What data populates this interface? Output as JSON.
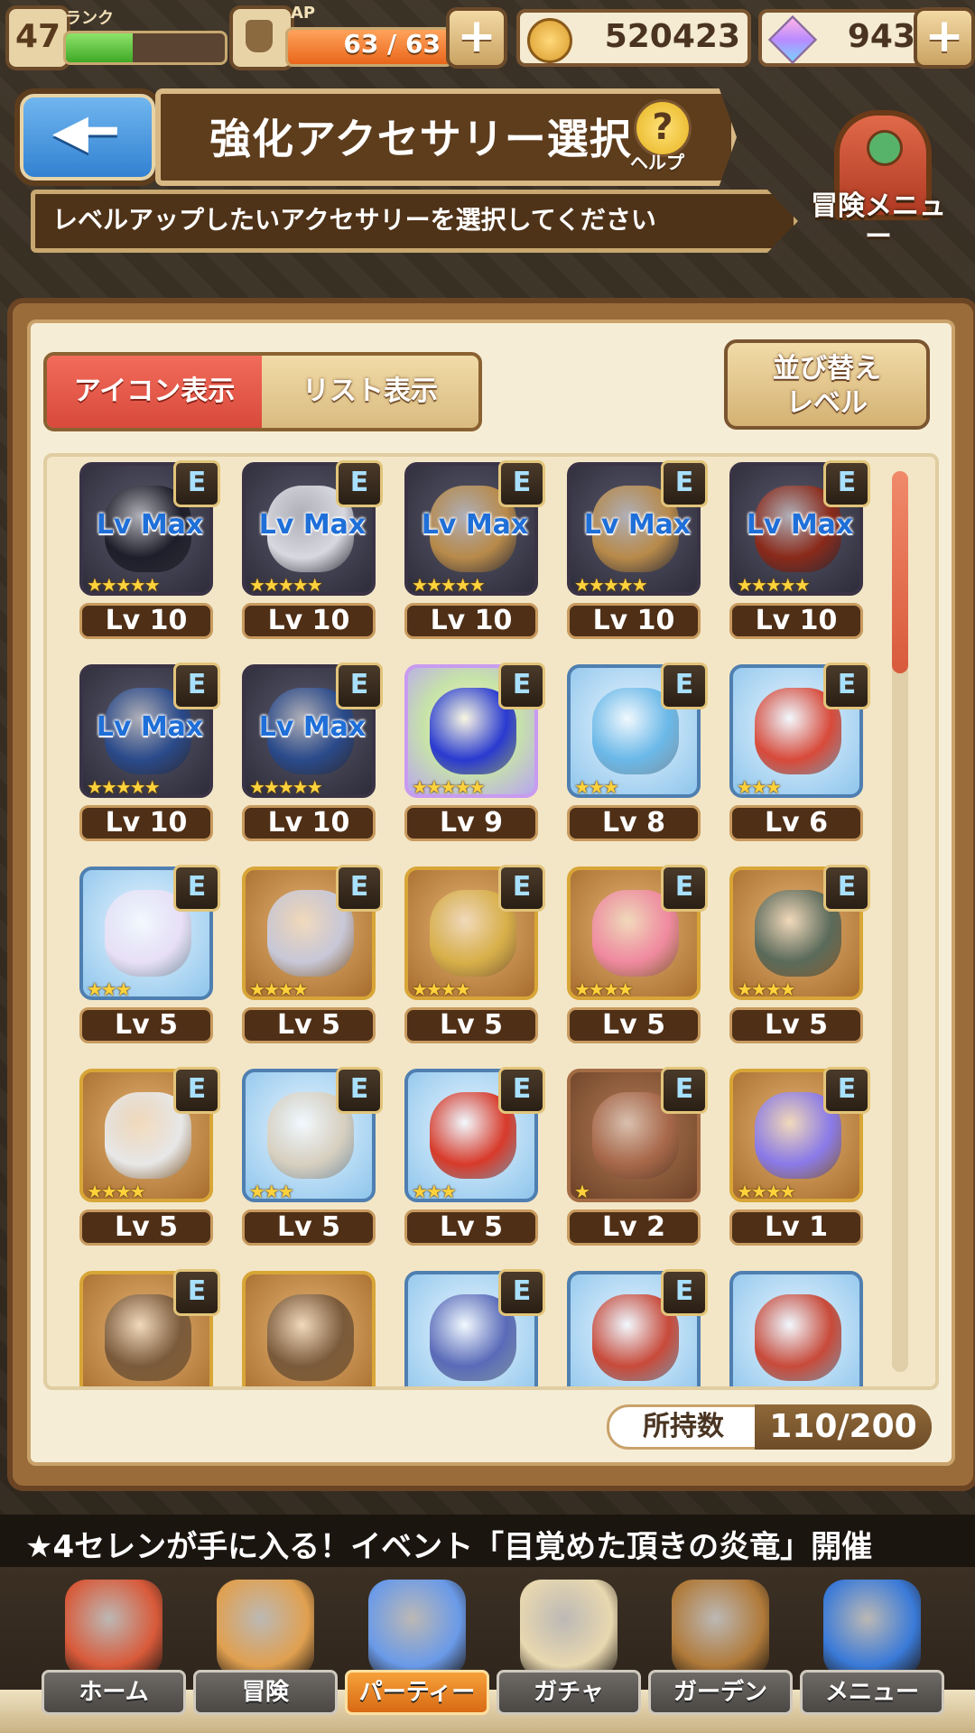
{
  "status": {
    "rank_level": "47",
    "rank_label": "ランク",
    "rank_progress": 0.42,
    "ap_label": "AP",
    "ap_value": "63 / 63",
    "ap_progress": 1.0,
    "coins": "520423",
    "gems": "943"
  },
  "header": {
    "title": "強化アクセサリー選択",
    "help_label": "ヘルプ",
    "subtitle": "レベルアップしたいアクセサリーを選択してください",
    "adventure_menu_label": "冒険メニュー"
  },
  "view_toggle": {
    "icon_view": "アイコン表示",
    "list_view": "リスト表示"
  },
  "sort_button": {
    "line1": "並び替え",
    "line2": "レベル"
  },
  "items": [
    {
      "lv": "Lv 10",
      "badge": "E",
      "lvmax": "Lv Max",
      "stars": "★★★★★",
      "rarity": "dark",
      "color": "#1e1e2a"
    },
    {
      "lv": "Lv 10",
      "badge": "E",
      "lvmax": "Lv Max",
      "stars": "★★★★★",
      "rarity": "dark",
      "color": "#d8d8e0"
    },
    {
      "lv": "Lv 10",
      "badge": "E",
      "lvmax": "Lv Max",
      "stars": "★★★★★",
      "rarity": "dark",
      "color": "#b88a4a"
    },
    {
      "lv": "Lv 10",
      "badge": "E",
      "lvmax": "Lv Max",
      "stars": "★★★★★",
      "rarity": "dark",
      "color": "#b88a4a"
    },
    {
      "lv": "Lv 10",
      "badge": "E",
      "lvmax": "Lv Max",
      "stars": "★★★★★",
      "rarity": "dark",
      "color": "#8a2a1a"
    },
    {
      "lv": "Lv 10",
      "badge": "E",
      "lvmax": "Lv Max",
      "stars": "★★★★★",
      "rarity": "dark",
      "color": "#2a4a8a"
    },
    {
      "lv": "Lv 10",
      "badge": "E",
      "lvmax": "Lv Max",
      "stars": "★★★★★",
      "rarity": "dark",
      "color": "#2a4a8a"
    },
    {
      "lv": "Lv 9",
      "badge": "E",
      "lvmax": "",
      "stars": "★★★★★",
      "rarity": "rainbow",
      "color": "#2a3ad0"
    },
    {
      "lv": "Lv 8",
      "badge": "E",
      "lvmax": "",
      "stars": "★★★",
      "rarity": "blue",
      "color": "#6ab8e8"
    },
    {
      "lv": "Lv 6",
      "badge": "E",
      "lvmax": "",
      "stars": "★★★",
      "rarity": "blue",
      "color": "#d84a3a"
    },
    {
      "lv": "Lv 5",
      "badge": "E",
      "lvmax": "",
      "stars": "★★★",
      "rarity": "blue",
      "color": "#e8e0f6"
    },
    {
      "lv": "Lv 5",
      "badge": "E",
      "lvmax": "",
      "stars": "★★★★",
      "rarity": "gold",
      "color": "#c8c8d8"
    },
    {
      "lv": "Lv 5",
      "badge": "E",
      "lvmax": "",
      "stars": "★★★★",
      "rarity": "gold",
      "color": "#d8b04a"
    },
    {
      "lv": "Lv 5",
      "badge": "E",
      "lvmax": "",
      "stars": "★★★★",
      "rarity": "gold",
      "color": "#f08aa0"
    },
    {
      "lv": "Lv 5",
      "badge": "E",
      "lvmax": "",
      "stars": "★★★★",
      "rarity": "gold",
      "color": "#5a6a5a"
    },
    {
      "lv": "Lv 5",
      "badge": "E",
      "lvmax": "",
      "stars": "★★★★",
      "rarity": "gold",
      "color": "#e8e8e8"
    },
    {
      "lv": "Lv 5",
      "badge": "E",
      "lvmax": "",
      "stars": "★★★",
      "rarity": "blue",
      "color": "#d8d0c0"
    },
    {
      "lv": "Lv 5",
      "badge": "E",
      "lvmax": "",
      "stars": "★★★",
      "rarity": "blue",
      "color": "#d83a2a"
    },
    {
      "lv": "Lv 2",
      "badge": "E",
      "lvmax": "",
      "stars": "★",
      "rarity": "bronze",
      "color": "#a8684a"
    },
    {
      "lv": "Lv 1",
      "badge": "E",
      "lvmax": "",
      "stars": "★★★★",
      "rarity": "gold",
      "color": "#8a7ae8"
    },
    {
      "lv": "",
      "badge": "E",
      "lvmax": "",
      "stars": "",
      "rarity": "gold",
      "color": "#7a5a3a"
    },
    {
      "lv": "",
      "badge": "",
      "lvmax": "",
      "stars": "",
      "rarity": "gold",
      "color": "#7a5a3a"
    },
    {
      "lv": "",
      "badge": "E",
      "lvmax": "",
      "stars": "",
      "rarity": "blue",
      "color": "#5a6ab8"
    },
    {
      "lv": "",
      "badge": "E",
      "lvmax": "",
      "stars": "",
      "rarity": "blue",
      "color": "#c84a3a"
    },
    {
      "lv": "",
      "badge": "",
      "lvmax": "",
      "stars": "",
      "rarity": "blue",
      "color": "#c84a3a"
    }
  ],
  "owned": {
    "label": "所持数",
    "value": "110/200"
  },
  "ticker": "★4セレンが手に入る！イベント「目覚めた頂きの炎竜」開催",
  "nav": [
    {
      "label": "ホーム",
      "icon": "house-icon",
      "active": false
    },
    {
      "label": "冒険",
      "icon": "compass-icon",
      "active": false
    },
    {
      "label": "パーティー",
      "icon": "chess-pieces-icon",
      "active": true
    },
    {
      "label": "ガチャ",
      "icon": "dice-icon",
      "active": false
    },
    {
      "label": "ガーデン",
      "icon": "basket-icon",
      "active": false
    },
    {
      "label": "メニュー",
      "icon": "book-icon",
      "active": false
    }
  ],
  "colors": {
    "accent_red": "#d84a3b",
    "panel_bg": "#f6edd7",
    "frame_brown": "#6b4424",
    "nav_active": "#d86a14"
  }
}
